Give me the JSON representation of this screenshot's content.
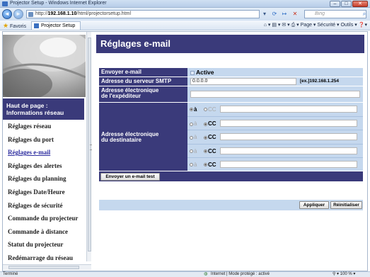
{
  "window": {
    "title": "Projector Setup - Windows Internet Explorer",
    "minimize": "–",
    "maximize": "□",
    "close": "✕"
  },
  "address": {
    "back": "◄",
    "forward": "►",
    "url_prefix": "http://",
    "url_host": "192.168.1.10",
    "url_path": "/html/projectorsetup.html",
    "search_placeholder": "Bing",
    "search_glyph": "⌕"
  },
  "favorites": {
    "label": "Favoris",
    "tab_label": "Projector Setup",
    "commands": "⌂ ▾ ▤ ▾ ✉ ▾ ⎙ ▾  Page ▾  Sécurité ▾  Outils ▾  ❓▾"
  },
  "sidebar": {
    "home_line1": "Haut de page :",
    "home_line2": "Informations réseau",
    "items": [
      {
        "label": "Réglages réseau",
        "active": false
      },
      {
        "label": "Réglages du port",
        "active": false
      },
      {
        "label": "Réglages e-mail",
        "active": true
      },
      {
        "label": "Réglages des alertes",
        "active": false
      },
      {
        "label": "Réglages du planning",
        "active": false
      },
      {
        "label": "Réglages Date/Heure",
        "active": false
      },
      {
        "label": "Réglages de sécurité",
        "active": false
      },
      {
        "label": "Commande du projecteur",
        "active": false
      },
      {
        "label": "Commande à distance",
        "active": false
      },
      {
        "label": "Statut du projecteur",
        "active": false
      },
      {
        "label": "Redémarrage du réseau",
        "active": false
      }
    ]
  },
  "main": {
    "title": "Réglages e-mail",
    "send_email_label": "Envoyer e-mail",
    "active_label": "Active",
    "smtp_label": "Adresse du serveur SMTP",
    "smtp_value": "0.0.0.0",
    "smtp_example": "[ex.]192.168.1.254",
    "sender_label_1": "Adresse électronique",
    "sender_label_2": "de l'expéditeur",
    "sender_value": "",
    "recipient_label_1": "Adresse électronique",
    "recipient_label_2": "du destinataire",
    "to_label": "à",
    "cc_label": "CC",
    "recipients": [
      {
        "to": true,
        "value": ""
      },
      {
        "to": false,
        "value": ""
      },
      {
        "to": false,
        "value": ""
      },
      {
        "to": false,
        "value": ""
      },
      {
        "to": false,
        "value": ""
      }
    ],
    "test_button": "Envoyer un e-mail test",
    "apply_button": "Appliquer",
    "reset_button": "Réinitialiser"
  },
  "status": {
    "left": "Terminé",
    "zone": "Internet | Mode protégé : activé",
    "zoom": "100 %"
  },
  "colors": {
    "header": "#3a3a7a",
    "row_bg": "#c5d8ee",
    "link_active": "#2e2ea0"
  }
}
